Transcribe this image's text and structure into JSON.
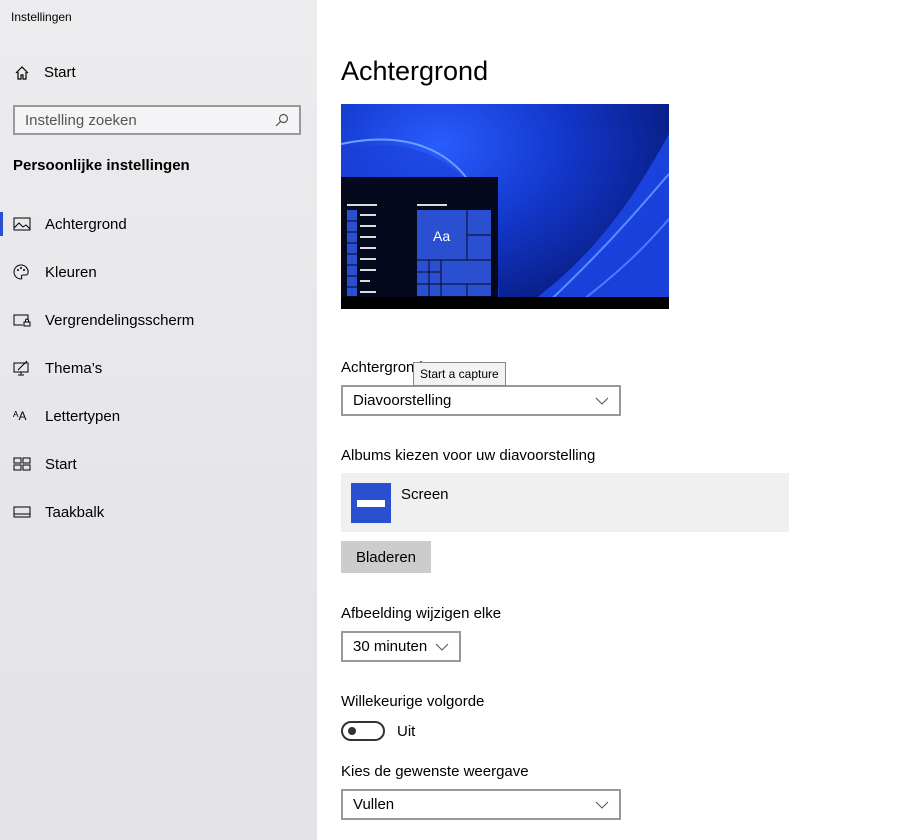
{
  "app_title": "Instellingen",
  "sidebar": {
    "home": "Start",
    "search_placeholder": "Instelling zoeken",
    "section": "Persoonlijke instellingen",
    "items": [
      {
        "label": "Achtergrond",
        "icon": "picture-icon",
        "active": true
      },
      {
        "label": "Kleuren",
        "icon": "palette-icon"
      },
      {
        "label": "Vergrendelingsscherm",
        "icon": "lock-screen-icon"
      },
      {
        "label": "Thema’s",
        "icon": "theme-icon"
      },
      {
        "label": "Lettertypen",
        "icon": "font-icon"
      },
      {
        "label": "Start",
        "icon": "start-icon"
      },
      {
        "label": "Taakbalk",
        "icon": "taskbar-icon"
      }
    ]
  },
  "main": {
    "title": "Achtergrond",
    "preview_sample": "Aa",
    "background_label": "Achtergrond",
    "background_value": "Diavoorstelling",
    "tooltip": "Start a capture",
    "albums_label": "Albums kiezen voor uw diavoorstelling",
    "album_name": "Screen",
    "browse_button": "Bladeren",
    "interval_label": "Afbeelding wijzigen elke",
    "interval_value": "30 minuten",
    "shuffle_label": "Willekeurige volgorde",
    "shuffle_state": "Uit",
    "fit_label": "Kies de gewenste weergave",
    "fit_value": "Vullen"
  },
  "colors": {
    "accent": "#2b4fd1"
  }
}
